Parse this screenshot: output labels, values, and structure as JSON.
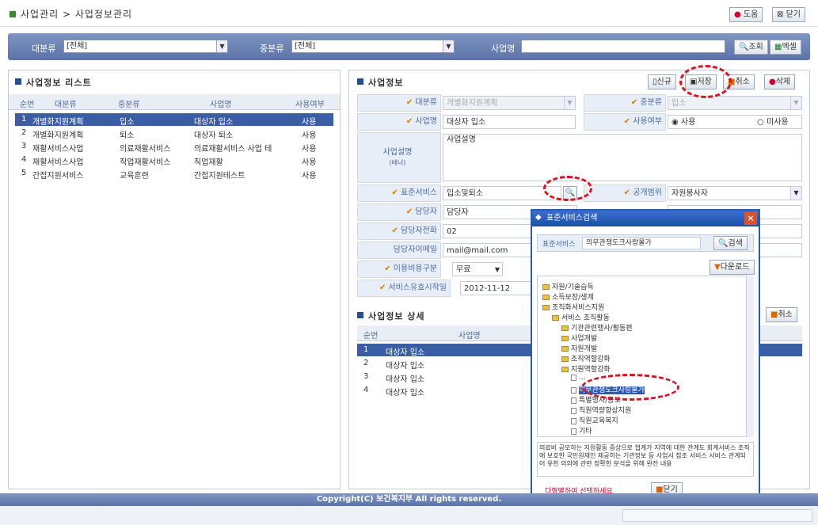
{
  "breadcrumb": {
    "text": "사업관리 > 사업정보관리"
  },
  "top_buttons": {
    "help": "도움",
    "close": "닫기"
  },
  "search": {
    "major_label": "대분류",
    "major_value": "[전체]",
    "middle_label": "중분류",
    "middle_value": "[전체]",
    "name_label": "사업명",
    "name_value": "",
    "query_btn": "조회",
    "excel_btn": "엑셀"
  },
  "list": {
    "title": "사업정보 리스트",
    "headers": [
      "순번",
      "대분류",
      "중분류",
      "사업명",
      "사용여부"
    ],
    "rows": [
      [
        "1",
        "개별화지원계획",
        "입소",
        "대상자 입소",
        "사용"
      ],
      [
        "2",
        "개별화지원계획",
        "퇴소",
        "대상자 퇴소",
        "사용"
      ],
      [
        "3",
        "재활서비스사업",
        "의료재활서비스",
        "의료재활서비스 사업 테",
        "사용"
      ],
      [
        "4",
        "재활서비스사업",
        "직업재활서비스",
        "직업재활",
        "사용"
      ],
      [
        "5",
        "간접지원서비스",
        "교육훈련",
        "간접지원테스트",
        "사용"
      ]
    ]
  },
  "info": {
    "title": "사업정보",
    "buttons": {
      "new": "신규",
      "save": "저장",
      "cancel": "취소",
      "delete": "삭제"
    },
    "major_label": "대분류",
    "major_value": "개별화지원계획",
    "middle_label": "중분류",
    "middle_value": "입소",
    "name_label": "사업명",
    "name_value": "대상자 입소",
    "use_label": "사용여부",
    "use_opt1": "사용",
    "use_opt2": "미사용",
    "desc_label": "사업설명",
    "desc_sub": "(배너)",
    "desc_value": "사업설명",
    "std_label": "표준서비스",
    "std_value": "입소및퇴소",
    "open_label": "공개범위",
    "open_value": "자원봉사자",
    "manager_label": "담당자",
    "manager_value": "담당자",
    "phone_label": "담당자전화",
    "phone_value": "02",
    "email_label": "담당자이메일",
    "email_value": "mail@mail.com",
    "fee_label": "이용비용구분",
    "fee_value": "무료",
    "start_label": "서비스유효시작일",
    "start_value": "2012-11-12"
  },
  "detail": {
    "title": "사업정보 상세",
    "cancel": "취소",
    "headers": [
      "순번",
      "사업명"
    ],
    "rows": [
      [
        "1",
        "대상자 입소"
      ],
      [
        "2",
        "대상자 입소"
      ],
      [
        "3",
        "대상자 입소"
      ],
      [
        "4",
        "대상자 입소"
      ]
    ]
  },
  "popup": {
    "title": "표준서비스검색",
    "search_label": "표준서비스",
    "search_value": "의무관쟁도크사랑물가",
    "search_btn": "검색",
    "download_btn": "다운로드",
    "tree": [
      "자원/기술습득",
      "소득보장/생계",
      "조직화서비스지원",
      "서비스 조직활동",
      "기관관련행사/활동편",
      "사업개발",
      "자원개발",
      "조직역할강화",
      "지원역할강화",
      "...",
      "의무관쟁도크사랑물가",
      "특별행사/공모",
      "직원역량향상지원",
      "직원교육복지",
      "기타"
    ],
    "desc": "의료비 공모하는 지원활동 증상으로 협계가 지역에 대한 관계도 회계서비스 조직에 보호한 국민원재인 제공하는 기관정보 등 사업서 참조 서비스 서비스 관계되어 유한 의의에 관련 정확한 분석을 위해 완전 내용",
    "footer_note": "다형별하여 선택하세요",
    "close_btn": "닫기"
  },
  "footer": {
    "copyright": "Copyright(C) 보건복지부 All rights reserved."
  }
}
